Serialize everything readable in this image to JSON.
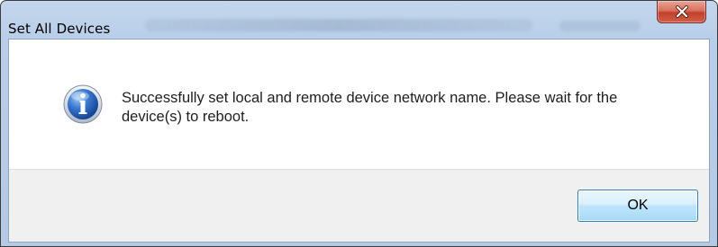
{
  "dialog": {
    "title": "Set All Devices",
    "message": "Successfully set local and remote device network name. Please wait for the device(s) to reboot.",
    "icon": "information-icon",
    "buttons": {
      "ok_label": "OK"
    }
  },
  "titlebar": {
    "close_icon": "close-icon"
  },
  "colors": {
    "titlebar": "#b9cfe9",
    "close_button": "#c0402a",
    "ok_button_border": "#3c7fb1",
    "footer": "#f0f0f0",
    "info_icon": "#2a5fb0"
  }
}
